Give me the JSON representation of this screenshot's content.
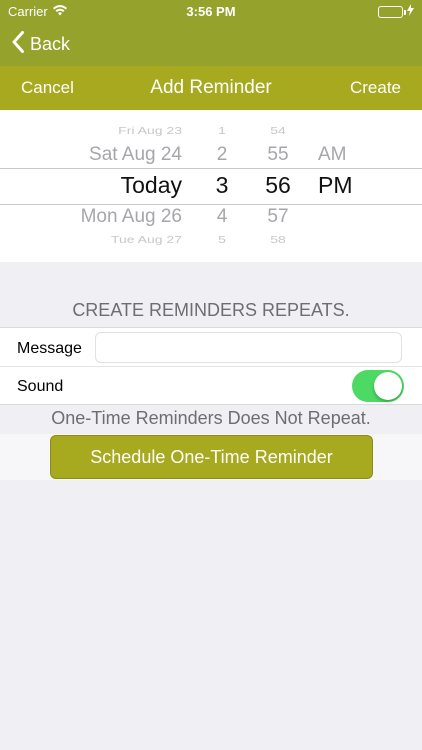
{
  "status_bar": {
    "carrier": "Carrier",
    "time": "3:56 PM"
  },
  "nav": {
    "back_label": "Back"
  },
  "sub_header": {
    "cancel_label": "Cancel",
    "title": "Add Reminder",
    "create_label": "Create"
  },
  "picker": {
    "day": [
      "Fri Aug 23",
      "Sat Aug 24",
      "Today",
      "Mon Aug 26",
      "Tue Aug 27"
    ],
    "hour": [
      "1",
      "2",
      "3",
      "4",
      "5"
    ],
    "minute": [
      "54",
      "55",
      "56",
      "57",
      "58"
    ],
    "ampm": [
      "",
      "AM",
      "PM",
      "",
      ""
    ]
  },
  "section_header": "CREATE REMINDERS REPEATS.",
  "form": {
    "message_label": "Message",
    "message_value": "",
    "message_placeholder": "",
    "sound_label": "Sound",
    "sound_on": true
  },
  "info_text": "One-Time Reminders Does Not Repeat.",
  "schedule_button_label": "Schedule One-Time Reminder",
  "colors": {
    "nav_bar": "#95a22c",
    "accent": "#a7a91f",
    "toggle_on": "#4cd964"
  }
}
